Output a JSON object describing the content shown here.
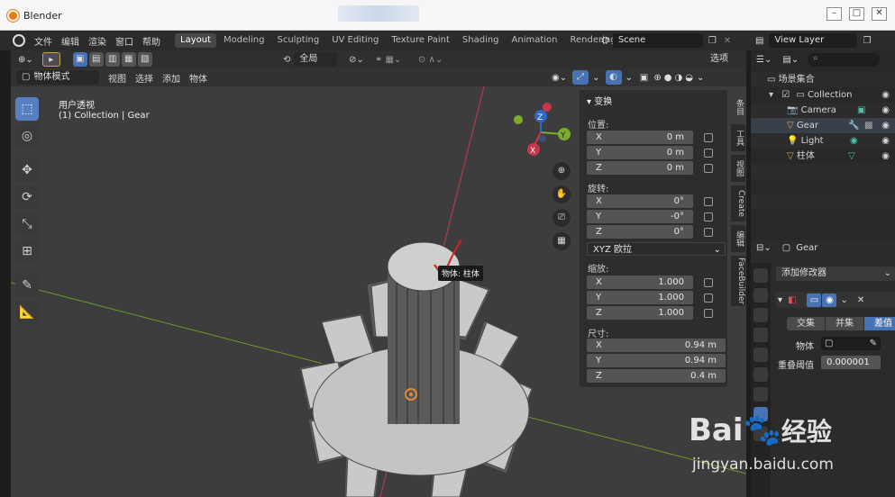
{
  "window": {
    "title": "Blender",
    "min": "–",
    "max": "□",
    "close": "✕"
  },
  "menu": {
    "items": [
      "文件",
      "编辑",
      "渲染",
      "窗口",
      "帮助"
    ]
  },
  "workspaces": [
    "Layout",
    "Modeling",
    "Sculpting",
    "UV Editing",
    "Texture Paint",
    "Shading",
    "Animation",
    "Rendering"
  ],
  "active_workspace": "Layout",
  "scene": {
    "name": "Scene",
    "view_layer": "View Layer"
  },
  "viewport": {
    "transform_orientation": "全局",
    "options_label": "选项",
    "mode": "物体模式",
    "menus": [
      "视图",
      "选择",
      "添加",
      "物体"
    ],
    "overlay_title": "用户透视",
    "overlay_sub": "(1) Collection | Gear",
    "tooltip": "物体: 柱体"
  },
  "npanel": {
    "header": "变换",
    "location_label": "位置:",
    "location": [
      {
        "axis": "X",
        "value": "0 m"
      },
      {
        "axis": "Y",
        "value": "0 m"
      },
      {
        "axis": "Z",
        "value": "0 m"
      }
    ],
    "rotation_label": "旋转:",
    "rotation": [
      {
        "axis": "X",
        "value": "0°"
      },
      {
        "axis": "Y",
        "value": "-0°"
      },
      {
        "axis": "Z",
        "value": "0°"
      }
    ],
    "rotation_mode": "XYZ 欧拉",
    "scale_label": "缩放:",
    "scale": [
      {
        "axis": "X",
        "value": "1.000"
      },
      {
        "axis": "Y",
        "value": "1.000"
      },
      {
        "axis": "Z",
        "value": "1.000"
      }
    ],
    "dimensions_label": "尺寸:",
    "dimensions": [
      {
        "axis": "X",
        "value": "0.94 m"
      },
      {
        "axis": "Y",
        "value": "0.94 m"
      },
      {
        "axis": "Z",
        "value": "0.4 m"
      }
    ]
  },
  "side_tabs": [
    "条目",
    "工具",
    "视图",
    "Create",
    "编辑",
    "FaceBuilder"
  ],
  "outliner": {
    "root": "场景集合",
    "collection": "Collection",
    "items": [
      "Camera",
      "Gear",
      "Light",
      "柱体"
    ]
  },
  "properties": {
    "object_name": "Gear",
    "add_modifier": "添加修改器",
    "ops": [
      "交集",
      "并集",
      "差值"
    ],
    "active_op": "差值",
    "object_label": "物体",
    "overlap_label": "重叠阈值",
    "overlap_value": "0.000001"
  },
  "watermark": {
    "brand": "Bai",
    "brand2": "经验",
    "url": "jingyan.baidu.com"
  },
  "colors": {
    "accent": "#4772b3",
    "x_axis": "#c6374a",
    "y_axis": "#7cad2f",
    "z_axis": "#2f68c6"
  }
}
